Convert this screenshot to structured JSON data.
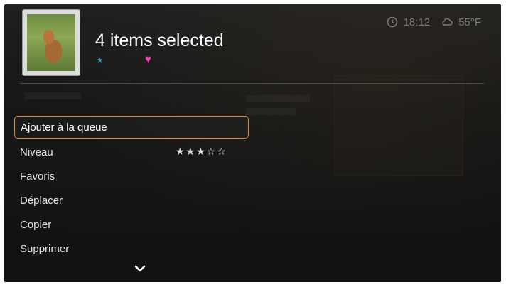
{
  "header": {
    "title": "4 items selected",
    "time": "18:12",
    "temperature": "55°F",
    "clock_icon": "clock-icon",
    "weather_icon": "cloud-icon",
    "tag_colors": {
      "star": "#3fa3e8",
      "heart": "#ff3fb7"
    }
  },
  "menu": {
    "items": [
      {
        "label": "Ajouter à la queue",
        "focused": true
      },
      {
        "label": "Niveau",
        "rating": 3,
        "rating_max": 5
      },
      {
        "label": "Favoris"
      },
      {
        "label": "Déplacer"
      },
      {
        "label": "Copier"
      },
      {
        "label": "Supprimer"
      }
    ],
    "focus_color": "#e08a28"
  },
  "scroll_indicator": "chevron-down-icon"
}
